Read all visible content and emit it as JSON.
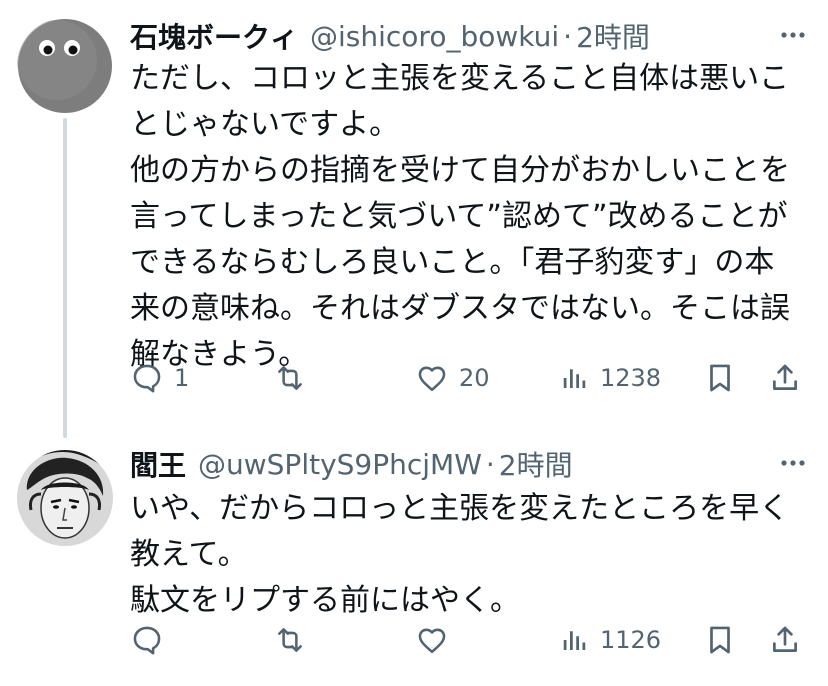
{
  "colors": {
    "text": "#0f1419",
    "secondary": "#536471",
    "thread_line": "#cfd9de"
  },
  "tweets": [
    {
      "display_name": "石塊ボークィ",
      "handle": "@ishicoro_bowkui",
      "separator": "·",
      "time": "2時間",
      "avatar": "gray-blob-with-eyes",
      "lines": [
        "ただし、コロッと主張を変えること自体は悪いこ",
        "とじゃないですよ。",
        "他の方からの指摘を受けて自分がおかしいことを",
        "言ってしまったと気づいて”認めて”改めることが",
        "できるならむしろ良いこと。「君子豹変す」の本",
        "来の意味ね。それはダブスタではない。そこは誤",
        "解なきよう。"
      ],
      "replies": "1",
      "retweets": "",
      "likes": "20",
      "views": "1238"
    },
    {
      "display_name": "閻王",
      "handle": "@uwSPltyS9PhcjMW",
      "separator": "·",
      "time": "2時間",
      "avatar": "manga-character-portrait",
      "lines": [
        "いや、だからコロっと主張を変えたところを早く",
        "教えて。",
        "駄文をリプする前にはやく。"
      ],
      "replies": "",
      "retweets": "",
      "likes": "",
      "views": "1126"
    }
  ],
  "icons": {
    "more": "more-dots-icon",
    "reply": "reply-bubble-icon",
    "retweet": "retweet-icon",
    "like": "heart-icon",
    "views": "views-bar-chart-icon",
    "bookmark": "bookmark-icon",
    "share": "share-icon"
  }
}
